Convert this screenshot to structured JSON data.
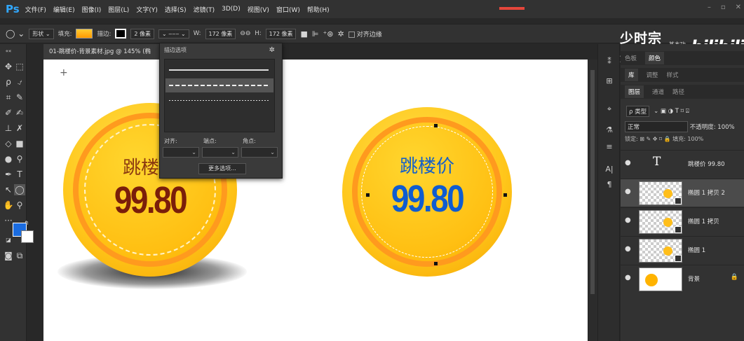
{
  "app": {
    "logo": "Ps",
    "menus": [
      "文件(F)",
      "编辑(E)",
      "图像(I)",
      "图层(L)",
      "文字(Y)",
      "选择(S)",
      "滤镜(T)",
      "3D(D)",
      "视图(V)",
      "窗口(W)",
      "帮助(H)"
    ],
    "window_controls": [
      "–",
      "▫",
      "✕"
    ]
  },
  "options": {
    "mode": "形状",
    "fill_label": "填充:",
    "stroke_label": "描边:",
    "stroke_width": "2 像素",
    "w_label": "W:",
    "w_value": "172 像素",
    "h_label": "H:",
    "h_value": "172 像素",
    "align_edges": "对齐边缘"
  },
  "watermark": {
    "text": "少时宗恣",
    "small": "基本功能",
    "logo": "bilibili"
  },
  "document": {
    "tab_title": "01-跳楼价-背景素材.jpg @ 145% (椭"
  },
  "coins": [
    {
      "title": "跳楼价",
      "price": "99.80",
      "title_color": "#8b3a10",
      "price_color": "#7a1e0a"
    },
    {
      "title": "跳楼价",
      "price": "99.80",
      "title_color": "#1560c8",
      "price_color": "#0f5cd0"
    }
  ],
  "stroke_popup": {
    "title": "描边选项",
    "align_label": "对齐:",
    "caps_label": "端点:",
    "corners_label": "角点:",
    "more_button": "更多选项..."
  },
  "panels": {
    "top_tabs": [
      "色板",
      "颜色"
    ],
    "mid_tabs": [
      "库",
      "调整",
      "样式"
    ],
    "layer_tabs": [
      "图层",
      "通道",
      "路径"
    ],
    "kind_filter": "ρ 类型",
    "blend_mode": "正常",
    "opacity_label": "不透明度:",
    "opacity_value": "100%",
    "lock_label": "锁定:",
    "fill_label": "填充:",
    "fill_value": "100%",
    "layers": [
      {
        "name": "跳楼价 99.80",
        "type": "text"
      },
      {
        "name": "椭圆 1 拷贝 2",
        "type": "shape"
      },
      {
        "name": "椭圆 1 拷贝",
        "type": "shape"
      },
      {
        "name": "椭圆 1",
        "type": "shape"
      },
      {
        "name": "背景",
        "type": "background"
      }
    ]
  }
}
